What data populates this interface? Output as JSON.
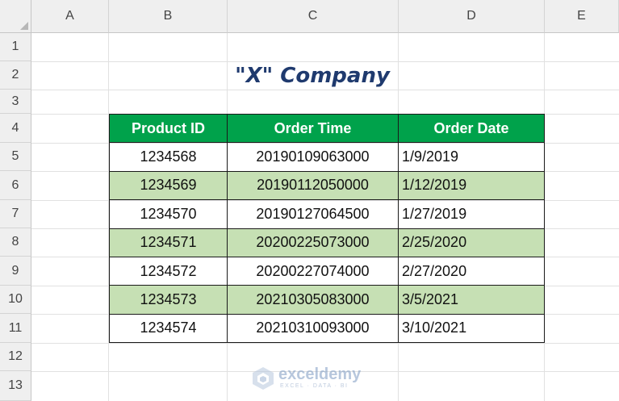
{
  "columns": [
    "A",
    "B",
    "C",
    "D",
    "E"
  ],
  "rows": [
    "1",
    "2",
    "3",
    "4",
    "5",
    "6",
    "7",
    "8",
    "9",
    "10",
    "11",
    "12",
    "13"
  ],
  "title": "\"X\" Company",
  "table": {
    "headers": [
      "Product ID",
      "Order Time",
      "Order Date"
    ],
    "rows": [
      [
        "1234568",
        "20190109063000",
        "1/9/2019"
      ],
      [
        "1234569",
        "20190112050000",
        "1/12/2019"
      ],
      [
        "1234570",
        "20190127064500",
        "1/27/2019"
      ],
      [
        "1234571",
        "20200225073000",
        "2/25/2020"
      ],
      [
        "1234572",
        "20200227074000",
        "2/27/2020"
      ],
      [
        "1234573",
        "20210305083000",
        "3/5/2021"
      ],
      [
        "1234574",
        "20210310093000",
        "3/10/2021"
      ]
    ]
  },
  "watermark": {
    "name": "exceldemy",
    "tagline": "EXCEL · DATA · BI"
  },
  "colors": {
    "header_green": "#00a24b",
    "band_green": "#c6e0b4",
    "title_blue": "#1f3a6e"
  }
}
